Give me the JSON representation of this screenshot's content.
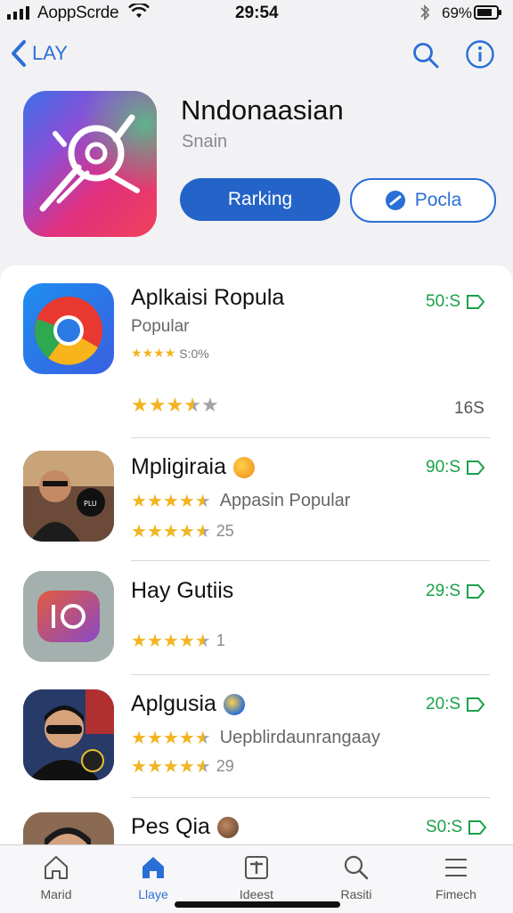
{
  "status_bar": {
    "carrier": "AoppScrde",
    "time": "29:54",
    "battery": "69%"
  },
  "nav": {
    "back_label": "LAY"
  },
  "app": {
    "title": "Nndonaasian",
    "subtitle": "Snain",
    "primary_button": "Rarking",
    "secondary_button": "Pocla",
    "accent_color": "#2464c8"
  },
  "list": [
    {
      "title": "Aplkaisi Ropula",
      "subtitle": "Popular",
      "small_rating": "S:0%",
      "price": "50:S",
      "stars": 4.4,
      "count": "16S",
      "icon": "chrome-icon"
    },
    {
      "title": "Mpligiraia",
      "subtitle": "Appasin Popular",
      "price": "90:S",
      "stars": 4.5,
      "count": "25",
      "icon": "person-photo"
    },
    {
      "title": "Hay Gutiis",
      "price": "29:S",
      "stars": 4.5,
      "count": "1",
      "icon": "instagram-like-icon"
    },
    {
      "title": "Aplgusia",
      "subtitle": "Uepblirdaunrangaay",
      "price": "20:S",
      "stars": 4.5,
      "count": "29",
      "icon": "person-sunglasses-photo"
    },
    {
      "title": "Pes Qia",
      "price": "S0:S",
      "icon": "person-photo"
    }
  ],
  "tabs": [
    {
      "label": "Marid",
      "icon": "home-icon"
    },
    {
      "label": "Llaye",
      "icon": "home-icon",
      "active": true
    },
    {
      "label": "Ideest",
      "icon": "add-icon"
    },
    {
      "label": "Rasiti",
      "icon": "search-icon"
    },
    {
      "label": "Fimech",
      "icon": "list-icon"
    }
  ]
}
